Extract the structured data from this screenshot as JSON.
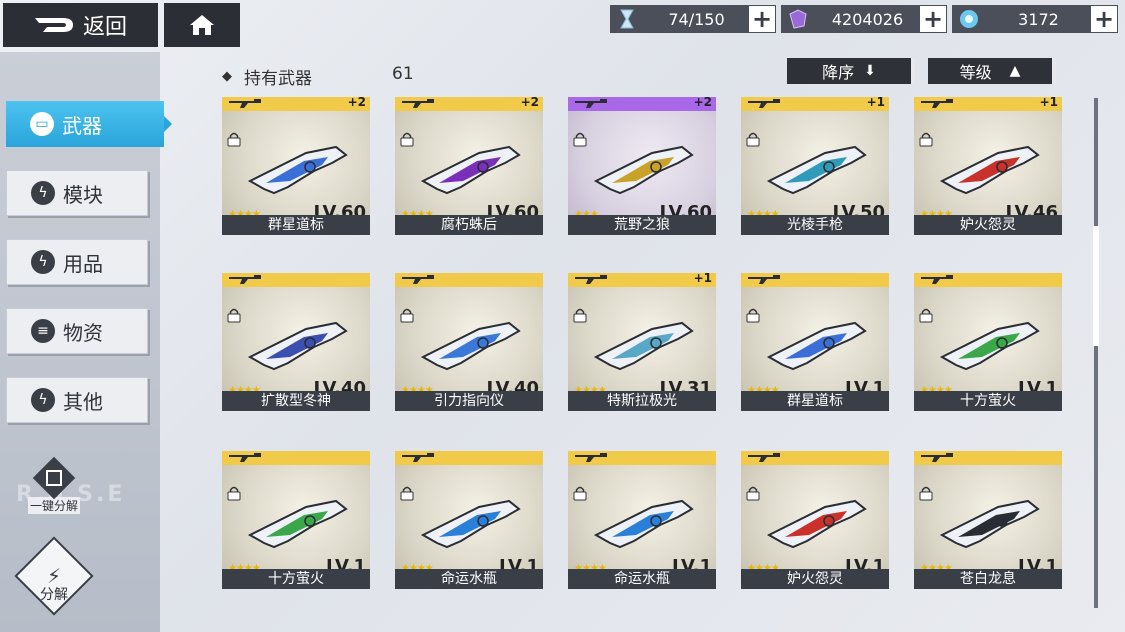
{
  "topbar": {
    "back_label": "返回",
    "resources": [
      {
        "icon": "hourglass-icon",
        "value": "74/150"
      },
      {
        "icon": "crystal-icon",
        "value": "4204026"
      },
      {
        "icon": "energy-orb-icon",
        "value": "3172"
      }
    ]
  },
  "header": {
    "owned_label": "持有武器",
    "owned_count": "61",
    "sort_desc_label": "降序",
    "sort_level_label": "等级"
  },
  "nav": [
    {
      "label": "武器",
      "icon": "gun-icon",
      "active": true
    },
    {
      "label": "模块",
      "icon": "bolt-icon",
      "active": false
    },
    {
      "label": "用品",
      "icon": "bolt-icon",
      "active": false
    },
    {
      "label": "物资",
      "icon": "supply-icon",
      "active": false
    },
    {
      "label": "其他",
      "icon": "bolt-icon",
      "active": false
    }
  ],
  "side_actions": {
    "one_click_dismantle": "一键分解",
    "dismantle": "分解",
    "watermark": "R.o.S.E"
  },
  "weapons": [
    {
      "name": "群星道标",
      "level": "LV.60",
      "stars": 4,
      "plus": "+2",
      "rarity": "gold",
      "color": "#3b6fd8"
    },
    {
      "name": "腐朽蛛后",
      "level": "LV.60",
      "stars": 4,
      "plus": "+2",
      "rarity": "gold",
      "color": "#7a2fb8"
    },
    {
      "name": "荒野之狼",
      "level": "LV.60",
      "stars": 3,
      "plus": "+2",
      "rarity": "purple",
      "color": "#c9a22a"
    },
    {
      "name": "光棱手枪",
      "level": "LV.50",
      "stars": 4,
      "plus": "+1",
      "rarity": "gold",
      "color": "#2f9bb8"
    },
    {
      "name": "妒火怨灵",
      "level": "LV.46",
      "stars": 4,
      "plus": "+1",
      "rarity": "gold",
      "color": "#c8322a"
    },
    {
      "name": "扩散型冬神",
      "level": "LV.40",
      "stars": 4,
      "plus": "",
      "rarity": "gold",
      "color": "#3a4fb0"
    },
    {
      "name": "引力指向仪",
      "level": "LV.40",
      "stars": 4,
      "plus": "",
      "rarity": "gold",
      "color": "#3b78d8"
    },
    {
      "name": "特斯拉极光",
      "level": "LV.31",
      "stars": 4,
      "plus": "+1",
      "rarity": "gold",
      "color": "#5aa8c8"
    },
    {
      "name": "群星道标",
      "level": "LV.1",
      "stars": 4,
      "plus": "",
      "rarity": "gold",
      "color": "#3b6fd8"
    },
    {
      "name": "十方萤火",
      "level": "LV.1",
      "stars": 4,
      "plus": "",
      "rarity": "gold",
      "color": "#3aa84a"
    },
    {
      "name": "十方萤火",
      "level": "LV.1",
      "stars": 4,
      "plus": "",
      "rarity": "gold",
      "color": "#3aa84a"
    },
    {
      "name": "命运水瓶",
      "level": "LV.1",
      "stars": 4,
      "plus": "",
      "rarity": "gold",
      "color": "#2a7fd8"
    },
    {
      "name": "命运水瓶",
      "level": "LV.1",
      "stars": 4,
      "plus": "",
      "rarity": "gold",
      "color": "#2a7fd8"
    },
    {
      "name": "妒火怨灵",
      "level": "LV.1",
      "stars": 4,
      "plus": "",
      "rarity": "gold",
      "color": "#c8322a"
    },
    {
      "name": "苍白龙息",
      "level": "LV.1",
      "stars": 4,
      "plus": "",
      "rarity": "gold",
      "color": "#2a2d33"
    }
  ]
}
